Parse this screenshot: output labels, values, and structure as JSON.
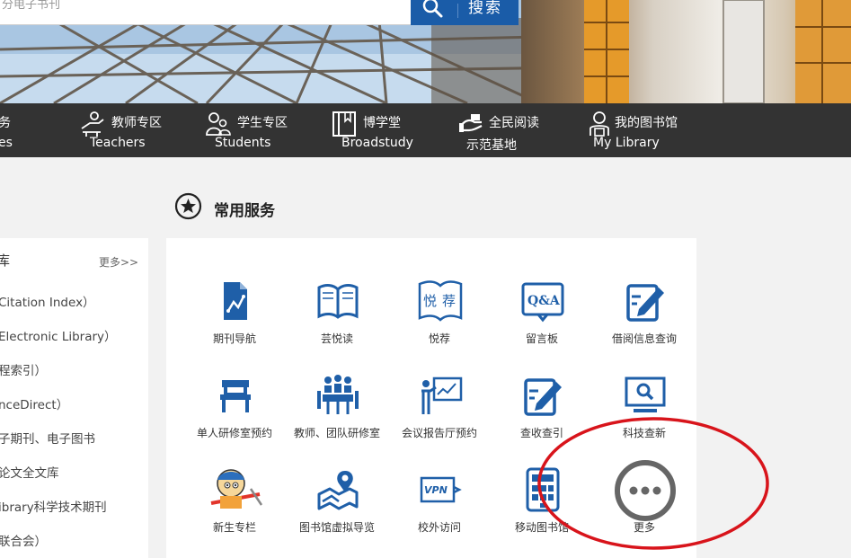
{
  "search": {
    "placeholder": "分电子书刊",
    "button_label": "搜索"
  },
  "nav": [
    {
      "cn": "务",
      "en": "es",
      "icon": "services-icon"
    },
    {
      "cn": "教师专区",
      "en": "Teachers",
      "icon": "teacher-icon"
    },
    {
      "cn": "学生专区",
      "en": "Students",
      "icon": "student-icon"
    },
    {
      "cn": "博学堂",
      "en": "Broadstudy",
      "icon": "book-icon"
    },
    {
      "cn": "全民阅读",
      "en": "示范基地",
      "icon": "reading-hands-icon"
    },
    {
      "cn": "我的图书馆",
      "en": "My Library",
      "icon": "my-library-icon"
    }
  ],
  "left": {
    "heading": "库",
    "more": "更多>>",
    "items": [
      "Citation Index）",
      "Electronic Library）",
      "程索引）",
      "nceDirect）",
      "子期刊、电子图书",
      "论文全文库",
      "ibrary科学技术期刊",
      "联合会）"
    ]
  },
  "section": {
    "title": "常用服务"
  },
  "services": [
    {
      "label": "期刊导航",
      "icon": "journal-nav-icon"
    },
    {
      "label": "芸悦读",
      "icon": "open-book-icon"
    },
    {
      "label": "悦荐",
      "icon": "yuejian-icon"
    },
    {
      "label": "留言板",
      "icon": "qa-board-icon"
    },
    {
      "label": "借阅信息查询",
      "icon": "borrow-query-icon"
    },
    {
      "label": "单人研修室预约",
      "icon": "study-room-icon"
    },
    {
      "label": "教师、团队研修室",
      "icon": "team-room-icon"
    },
    {
      "label": "会议报告厅预约",
      "icon": "presentation-icon"
    },
    {
      "label": "查收查引",
      "icon": "citation-check-icon"
    },
    {
      "label": "科技查新",
      "icon": "monitor-search-icon"
    },
    {
      "label": "新生专栏",
      "icon": "freshman-cartoon-icon"
    },
    {
      "label": "图书馆虚拟导览",
      "icon": "map-pin-icon"
    },
    {
      "label": "校外访问",
      "icon": "vpn-icon"
    },
    {
      "label": "移动图书馆",
      "icon": "mobile-library-icon"
    },
    {
      "label": "更多",
      "icon": "more-dots-icon"
    }
  ],
  "colors": {
    "brand_blue": "#1a5ca8",
    "icon_blue": "#1f5fa8",
    "nav_bg": "#333333",
    "annotation_red": "#d8141b"
  }
}
